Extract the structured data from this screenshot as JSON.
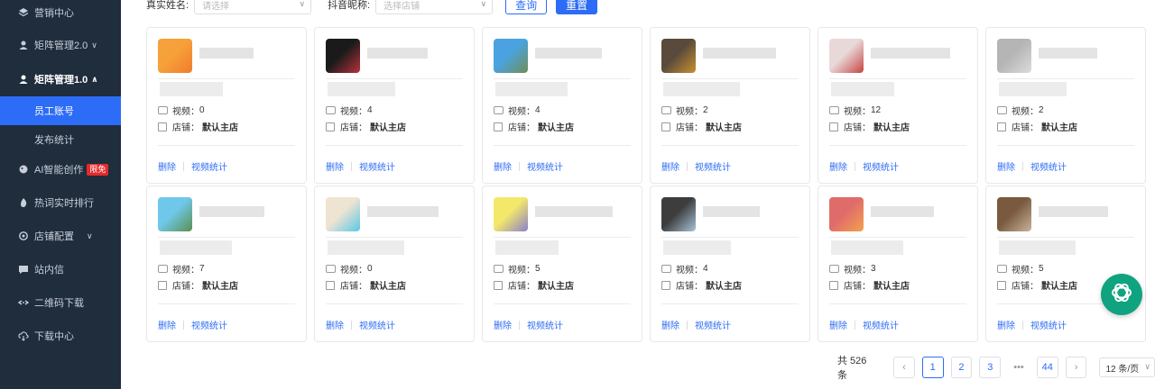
{
  "sidebar": {
    "items": [
      {
        "label": "营销中心",
        "icon": "layers-icon"
      },
      {
        "label": "矩阵管理2.0",
        "icon": "user-icon"
      },
      {
        "label": "矩阵管理1.0",
        "icon": "user-icon"
      },
      {
        "label": "AI智能创作",
        "icon": "sparkle-icon",
        "badge": "限免"
      },
      {
        "label": "热词实时排行",
        "icon": "flame-icon"
      },
      {
        "label": "店铺配置",
        "icon": "settings-icon"
      },
      {
        "label": "站内信",
        "icon": "message-icon"
      },
      {
        "label": "二维码下载",
        "icon": "link-icon"
      },
      {
        "label": "下载中心",
        "icon": "cloud-download-icon"
      }
    ],
    "sub_items": [
      {
        "label": "员工账号",
        "active": true
      },
      {
        "label": "发布统计",
        "active": false
      }
    ]
  },
  "filters": {
    "name_label": "真实姓名:",
    "name_placeholder": "请选择",
    "nick_label": "抖音昵称:",
    "nick_placeholder": "选择店铺",
    "query_button": "查询",
    "reset_button": "重置"
  },
  "cards": [
    {
      "videos": "0",
      "shop": "默认主店"
    },
    {
      "videos": "4",
      "shop": "默认主店"
    },
    {
      "videos": "4",
      "shop": "默认主店"
    },
    {
      "videos": "2",
      "shop": "默认主店"
    },
    {
      "videos": "12",
      "shop": "默认主店"
    },
    {
      "videos": "2",
      "shop": "默认主店"
    },
    {
      "videos": "7",
      "shop": "默认主店"
    },
    {
      "videos": "0",
      "shop": "默认主店"
    },
    {
      "videos": "5",
      "shop": "默认主店"
    },
    {
      "videos": "4",
      "shop": "默认主店"
    },
    {
      "videos": "3",
      "shop": "默认主店"
    },
    {
      "videos": "5",
      "shop": "默认主店"
    }
  ],
  "card_labels": {
    "video": "视频：",
    "shop": "店铺：",
    "delete": "删除",
    "video_stats": "视频统计"
  },
  "pagination": {
    "total": "共 526 条",
    "pages": [
      "1",
      "2",
      "3",
      "44"
    ],
    "ellipsis": "•••",
    "current": "1",
    "per_page": "12 条/页"
  },
  "colors": {
    "sidebar_bg": "#1f2d3d",
    "accent": "#2d6cf6",
    "badge": "#e62b2b",
    "fab": "#10a37f"
  }
}
